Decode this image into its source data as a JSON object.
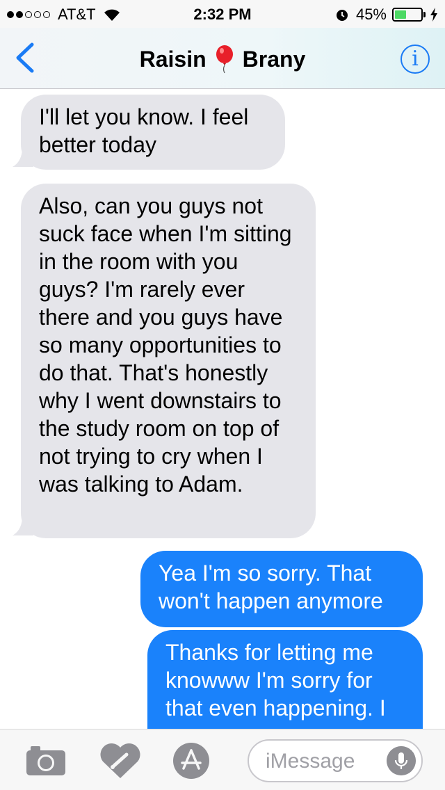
{
  "status_bar": {
    "carrier": "AT&T",
    "signal_bars_filled": 2,
    "signal_bars_total": 5,
    "time": "2:32 PM",
    "battery_text": "45%",
    "battery_level": 0.45,
    "icons": [
      "wifi-icon",
      "alarm-icon",
      "battery-icon",
      "charging-icon"
    ]
  },
  "nav": {
    "back_icon": "chevron-left-icon",
    "title_part1": "Raisin",
    "title_emoji": "balloon-icon",
    "title_part2": "Brany",
    "info_label": "i"
  },
  "messages": [
    {
      "direction": "received",
      "text": "I'll let you know. I feel better today"
    },
    {
      "direction": "received",
      "text": "Also, can you guys not suck face when I'm sitting in the room with you guys? I'm rarely ever there and you guys have so many opportunities to do that. That's honestly why I went downstairs to the study room on top of not trying to cry when I was talking to Adam."
    },
    {
      "direction": "sent",
      "text": "Yea I'm so sorry. That won't happen anymore"
    },
    {
      "direction": "sent",
      "text": "Thanks for letting me knowww I'm sorry for that even happening. I"
    }
  ],
  "input_bar": {
    "placeholder": "iMessage",
    "icons": [
      "camera-icon",
      "digital-touch-icon",
      "app-store-icon",
      "microphone-icon"
    ]
  },
  "colors": {
    "sent_bubble": "#1a82fb",
    "received_bubble": "#e5e5ea",
    "accent": "#1a7bf5",
    "battery_fill": "#4cd964"
  }
}
